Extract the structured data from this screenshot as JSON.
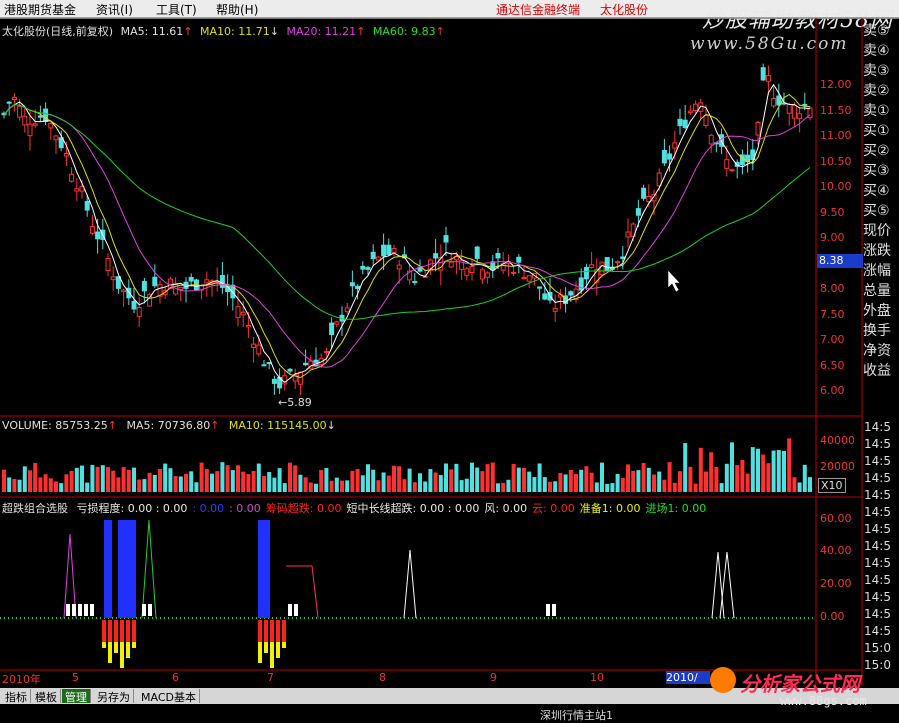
{
  "menubar": {
    "items": [
      "港股期货基金",
      "资讯(I)",
      "工具(T)",
      "帮助(H)"
    ],
    "promo": "通达信金融终端",
    "stock": "太化股份"
  },
  "watermark": {
    "line1": "炒股辅助教材58网",
    "line2": "www.58Gu.com"
  },
  "price_panel": {
    "title": "太化股份(日线,前复权)",
    "ma5": "MA5: 11.61",
    "ma10": "MA10: 11.71",
    "ma20": "MA20: 11.21",
    "ma60": "MA60: 9.83",
    "low_label": "←5.89",
    "current_price": "8.38",
    "y_ticks": [
      "12.00",
      "11.50",
      "11.00",
      "10.50",
      "10.00",
      "9.50",
      "9.00",
      "8.50",
      "8.00",
      "7.50",
      "7.00",
      "6.50",
      "6.00"
    ]
  },
  "volume_panel": {
    "volume": "VOLUME: 85753.25",
    "ma5": "MA5: 70736.80",
    "ma10": "MA10: 115145.00",
    "y_ticks": [
      "40000",
      "20000"
    ],
    "unit": "X10"
  },
  "indicator_panel": {
    "name": "超跌组合选股",
    "items": [
      {
        "text": "亏损程度: 0.00 : 0.00",
        "color": "#e8e8e8"
      },
      {
        "text": ": 0.00",
        "color": "#3a3aff"
      },
      {
        "text": ": 0.00",
        "color": "#d24ad2"
      },
      {
        "text": "筹码超跌: 0.00",
        "color": "#ff2020"
      },
      {
        "text": "短中长线超跌: 0.00 : 0.00",
        "color": "#e8e8e8"
      },
      {
        "text": "风: 0.00",
        "color": "#e8e8e8"
      },
      {
        "text": "云: 0.00",
        "color": "#ff2020"
      },
      {
        "text": "准备1: 0.00",
        "color": "#f0f000"
      },
      {
        "text": "进场1: 0.00",
        "color": "#20e020"
      }
    ],
    "y_ticks": [
      "60.00",
      "40.00",
      "20.00",
      "0.00"
    ]
  },
  "order_book": [
    "卖⑤",
    "卖④",
    "卖③",
    "卖②",
    "卖①",
    "买①",
    "买②",
    "买③",
    "买④",
    "买⑤",
    "现价",
    "涨跌",
    "涨幅",
    "总量",
    "外盘",
    "换手",
    "净资",
    "收益"
  ],
  "side_times": [
    "14:5",
    "14:5",
    "14:5",
    "14:5",
    "14:5",
    "14:5",
    "14:5",
    "14:5",
    "14:5",
    "14:5",
    "14:5",
    "14:5",
    "14:5",
    "15:0",
    "15:0"
  ],
  "x_axis": {
    "labels": [
      "2010年",
      "5",
      "6",
      "7",
      "8",
      "9",
      "10"
    ],
    "highlight": "2010/"
  },
  "bottom_tabs": [
    "指标",
    "模板",
    "管理",
    "另存为",
    "MACD基本"
  ],
  "logo": {
    "name": "分析家公式网",
    "url": "www.88gs.com"
  },
  "statusbar": {
    "text": "深圳行情主站1"
  }
}
